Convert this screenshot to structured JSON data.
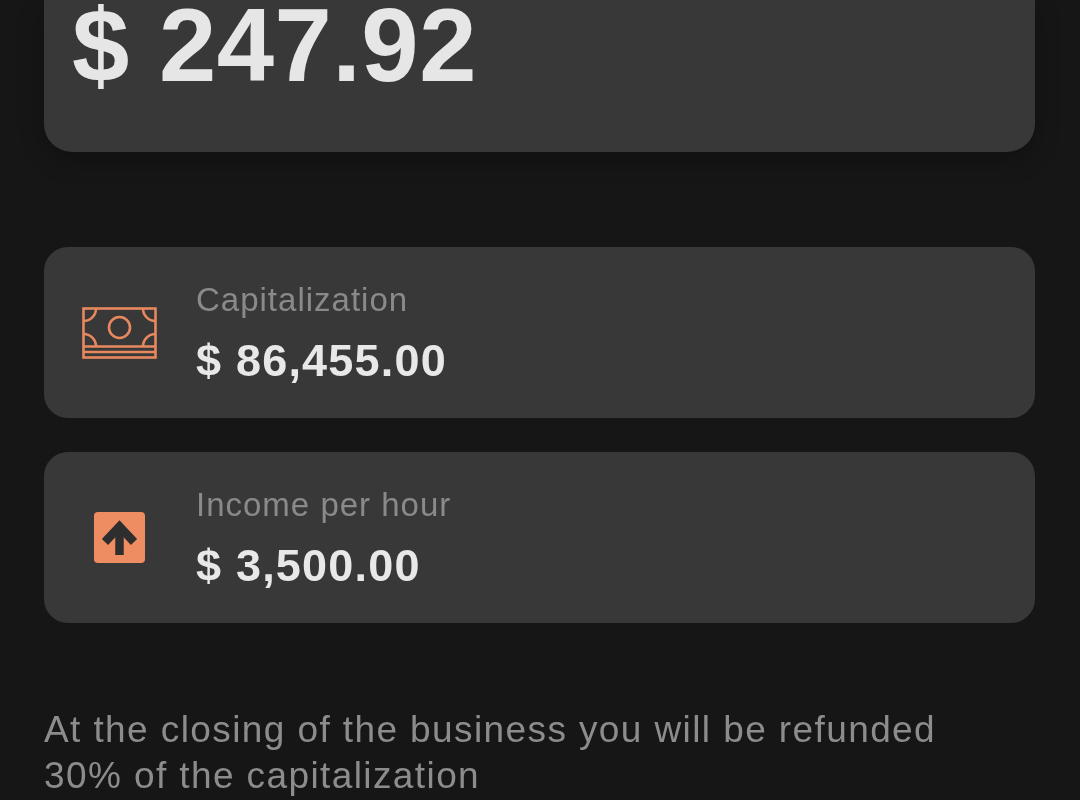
{
  "balance": {
    "amount": "$ 247.92"
  },
  "stats": [
    {
      "kind": "money",
      "label": "Capitalization",
      "value": "$ 86,455.00"
    },
    {
      "kind": "arrow",
      "label": "Income per hour",
      "value": "$ 3,500.00"
    }
  ],
  "note": "At the closing of the business you will be refunded 30% of the capitalization"
}
